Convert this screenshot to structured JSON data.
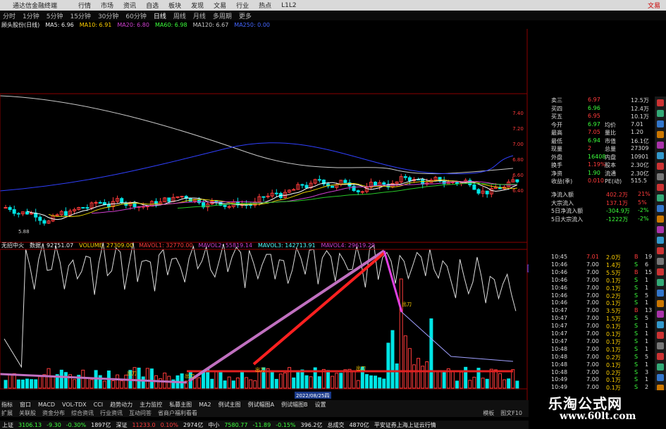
{
  "menubar": {
    "app_title": "通达信金融终端",
    "items": [
      "行情",
      "市场",
      "资讯",
      "自选",
      "板块",
      "发现",
      "文易",
      "行业",
      "热点",
      "L1L2"
    ],
    "right": "文易"
  },
  "toolbar": {
    "items": [
      "分时",
      "1分钟",
      "5分钟",
      "15分钟",
      "30分钟",
      "60分钟",
      "日线",
      "周线",
      "月线",
      "多周期",
      "更多"
    ],
    "selected_index": 6
  },
  "ma_labels": {
    "stock": "顾头股份(日线)",
    "ma5": "MA5: 6.96",
    "ma10": "MA10: 6.91",
    "ma20": "MA20: 6.80",
    "ma60": "MA60: 6.98",
    "ma120": "MA120: 6.67",
    "extra": "MA250: 0.00"
  },
  "price_axis": [
    "7.40",
    "7.20",
    "7.00",
    "6.80",
    "6.60",
    "6.40"
  ],
  "price_low_label": "5.88",
  "vol_labels": {
    "name": "无招中火",
    "v1": "数据",
    "v2": "92751.07",
    "volume": "VOLUME: 27309.00",
    "mavol1": "MAVOL1: 32770.00",
    "mavol2": "MAVOL2: 55819.14",
    "mavol3": "MAVOL3: 142713.91",
    "mavol4": "MAVOL4: 29619.29"
  },
  "vol_axis": [
    "50000",
    "45000",
    "40000",
    "35000",
    "30000",
    "25000",
    "20000",
    "15000",
    "10000",
    "5000"
  ],
  "vol_axis_top": "53391",
  "date_label": "2022/08/25四",
  "chart_annotations": [
    "出刀",
    "出刀",
    "出刀",
    "出刀",
    "出刀"
  ],
  "right_panel": {
    "quotes": [
      {
        "k": "卖三",
        "v1": "6.97",
        "v2": "12.5万"
      },
      {
        "k": "买四",
        "v1": "6.96",
        "v2": "12.4万"
      },
      {
        "k": "买五",
        "v1": "6.95",
        "v2": "10.1万"
      },
      {
        "k": "今开",
        "v1": "6.97",
        "k2": "均价",
        "v2": "7.01"
      },
      {
        "k": "最高",
        "v1": "7.05",
        "k2": "量比",
        "v2": "1.20"
      },
      {
        "k": "最低",
        "v1": "6.94",
        "k2": "市值",
        "v2": "16.1亿"
      },
      {
        "k": "现量",
        "v1": "2",
        "k2": "总量",
        "v2": "27309"
      },
      {
        "k": "外盘",
        "v1": "16408",
        "k2": "内盘",
        "v2": "10901"
      },
      {
        "k": "换手",
        "v1": "1.19%",
        "k2": "股本",
        "v2": "2.30亿"
      },
      {
        "k": "净资",
        "v1": "1.90",
        "k2": "流通",
        "v2": "2.30亿"
      },
      {
        "k": "收益(季)",
        "v1": "0.010",
        "k2": "PE(动)",
        "v2": "515.5"
      }
    ],
    "flows": [
      {
        "k": "净流入额",
        "v1": "402.2万",
        "v2": "21%"
      },
      {
        "k": "大宗流入",
        "v1": "137.1万",
        "v2": "5%"
      },
      {
        "k": "5日净流入额",
        "v1": "-304.9万",
        "v2": "-2%"
      },
      {
        "k": "5日大宗流入",
        "v1": "-1222万",
        "v2": "-2%"
      }
    ],
    "trades": [
      {
        "t": "10:45",
        "p": "7.01",
        "v": "2.0万",
        "d": "B",
        "n": "19"
      },
      {
        "t": "10:46",
        "p": "7.00",
        "v": "1.4万",
        "d": "S",
        "n": "6"
      },
      {
        "t": "10:46",
        "p": "7.00",
        "v": "5.5万",
        "d": "B",
        "n": "15"
      },
      {
        "t": "10:46",
        "p": "7.00",
        "v": "0.1万",
        "d": "S",
        "n": "1"
      },
      {
        "t": "10:46",
        "p": "7.00",
        "v": "0.1万",
        "d": "S",
        "n": "1"
      },
      {
        "t": "10:46",
        "p": "7.00",
        "v": "0.2万",
        "d": "S",
        "n": "5"
      },
      {
        "t": "10:46",
        "p": "7.00",
        "v": "0.1万",
        "d": "S",
        "n": "1"
      },
      {
        "t": "10:47",
        "p": "7.00",
        "v": "3.5万",
        "d": "B",
        "n": "13"
      },
      {
        "t": "10:47",
        "p": "7.00",
        "v": "1.5万",
        "d": "S",
        "n": "5"
      },
      {
        "t": "10:47",
        "p": "7.00",
        "v": "0.1万",
        "d": "S",
        "n": "1"
      },
      {
        "t": "10:47",
        "p": "7.00",
        "v": "0.1万",
        "d": "S",
        "n": "1"
      },
      {
        "t": "10:47",
        "p": "7.00",
        "v": "0.1万",
        "d": "S",
        "n": "1"
      },
      {
        "t": "10:48",
        "p": "7.00",
        "v": "0.1万",
        "d": "S",
        "n": "1"
      },
      {
        "t": "10:48",
        "p": "7.00",
        "v": "0.2万",
        "d": "S",
        "n": "5"
      },
      {
        "t": "10:48",
        "p": "7.00",
        "v": "0.1万",
        "d": "S",
        "n": "1"
      },
      {
        "t": "10:48",
        "p": "7.00",
        "v": "0.2万",
        "d": "S",
        "n": "3"
      },
      {
        "t": "10:49",
        "p": "7.00",
        "v": "0.1万",
        "d": "S",
        "n": "1"
      },
      {
        "t": "10:49",
        "p": "7.00",
        "v": "0.1万",
        "d": "S",
        "n": "2"
      },
      {
        "t": "10:49",
        "p": "6.99",
        "v": "0.1万",
        "d": "S",
        "n": "1"
      },
      {
        "t": "10:49",
        "p": "6.99",
        "v": "0.2万",
        "d": "S",
        "n": "1"
      }
    ]
  },
  "index_tabs": [
    "指标",
    "窗口",
    "MACD",
    "VOL-TDX",
    "CCI",
    "趋势动力",
    "主力监控",
    "私募主图",
    "MA2",
    "例试主图",
    "例试幅图A",
    "例试幅图B",
    "设置"
  ],
  "sub_tabs": [
    "扩展",
    "关联股",
    "资金分布",
    "综合资讯",
    "行业资讯",
    "互动问答",
    "省商户福利看看"
  ],
  "sub_right": [
    "模板",
    "图文F10"
  ],
  "status": {
    "sh_label": "上证",
    "sh": "3106.13",
    "sh_chg": "-9.30",
    "sh_pct": "-0.30%",
    "sh_amt": "1897亿",
    "sz_label": "深证",
    "sz": "11233.0",
    "sz_pct": "0.10%",
    "sz_amt": "2974亿",
    "zx_label": "中小",
    "zx": "7580.77",
    "zx_chg": "-11.89",
    "zx_pct": "-0.15%",
    "zx_amt": "396.2亿",
    "total_label": "总成交",
    "total": "4870亿",
    "broker": "平安证券上海上证云行情"
  },
  "watermark": {
    "line1": "乐淘公式网",
    "line2": "www.60lt.com"
  },
  "colors": {
    "up": "#ff3b3b",
    "down": "#00e5e5",
    "ma5": "#ffffff",
    "ma10": "#e6d200",
    "ma20": "#d040d0",
    "ma60": "#28c828",
    "ma120": "#c8c8c8",
    "arrow_pink": "#c070c0",
    "arrow_red": "#ff2020"
  }
}
